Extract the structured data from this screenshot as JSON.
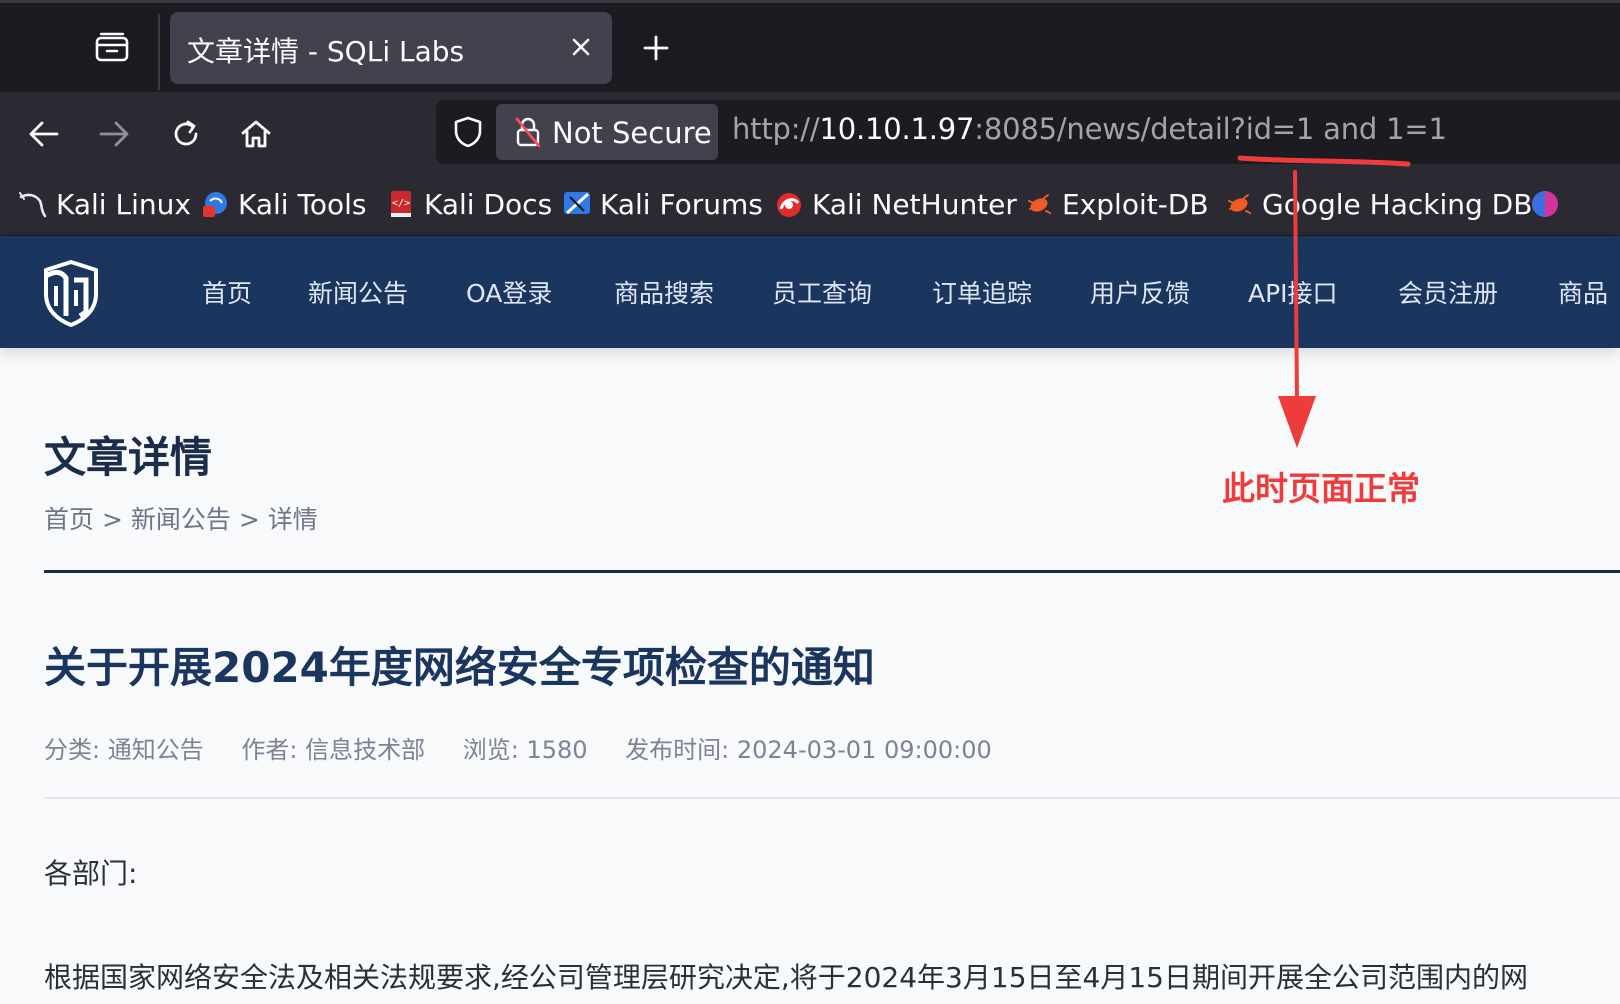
{
  "browser": {
    "tab_title": "文章详情 - SQLi Labs",
    "security_label": "Not Secure",
    "url": {
      "scheme": "http://",
      "host": "10.10.1.97",
      "rest": ":8085/news/detail?id=1 and 1=1"
    },
    "bookmarks": [
      {
        "label": "Kali Linux",
        "icon": "kali-dragon-icon"
      },
      {
        "label": "Kali Tools",
        "icon": "kali-tools-icon"
      },
      {
        "label": "Kali Docs",
        "icon": "kali-docs-icon"
      },
      {
        "label": "Kali Forums",
        "icon": "kali-forums-icon"
      },
      {
        "label": "Kali NetHunter",
        "icon": "kali-nethunter-icon"
      },
      {
        "label": "Exploit-DB",
        "icon": "exploit-db-icon"
      },
      {
        "label": "Google Hacking DB",
        "icon": "ghdb-icon"
      }
    ]
  },
  "site": {
    "nav": [
      "首页",
      "新闻公告",
      "OA登录",
      "商品搜索",
      "员工查询",
      "订单追踪",
      "用户反馈",
      "API接口",
      "会员注册",
      "商品"
    ]
  },
  "page": {
    "title": "文章详情",
    "breadcrumb": [
      "首页",
      "新闻公告",
      "详情"
    ],
    "breadcrumb_sep": ">",
    "article": {
      "title": "关于开展2024年度网络安全专项检查的通知",
      "category": "分类: 通知公告",
      "author": "作者: 信息技术部",
      "views": "浏览: 1580",
      "published": "发布时间: 2024-03-01 09:00:00",
      "greeting": "各部门:",
      "paragraph": "根据国家网络安全法及相关法规要求,经公司管理层研究决定,将于2024年3月15日至4月15日期间开展全公司范围内的网"
    }
  },
  "annotation": {
    "text": "此时页面正常",
    "color": "#ee3b3b"
  },
  "colors": {
    "site_header": "#1b365e",
    "browser_dark": "#1c1b22",
    "toolbar": "#2b2a33"
  }
}
